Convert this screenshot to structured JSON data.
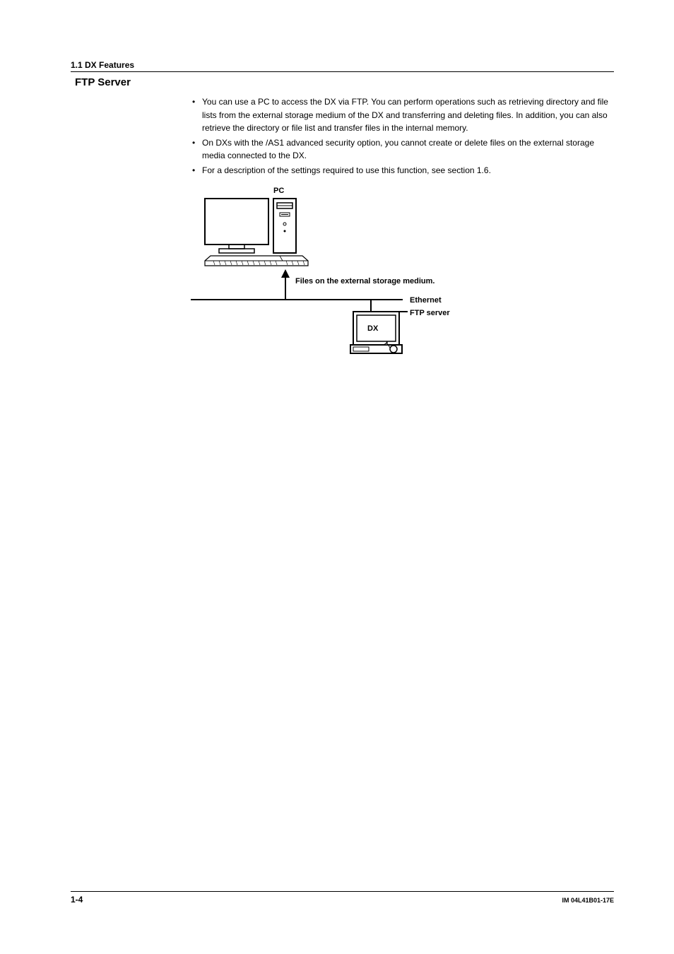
{
  "header": {
    "section": "1.1  DX Features"
  },
  "title": "FTP Server",
  "bullets": [
    "You can use a PC to access the DX via FTP.  You can perform operations such as retrieving directory and file lists from the external storage medium of the DX and transferring and deleting files.  In addition, you can also retrieve the directory or file list and transfer files in the internal memory.",
    "On DXs with the /AS1 advanced security option, you cannot create or delete files on the external storage media connected to the DX.",
    "For a description of the settings required to use this function, see section 1.6."
  ],
  "diagram": {
    "pc_label": "PC",
    "arrow_label": "Files on the external storage medium.",
    "ethernet_label": "Ethernet",
    "ftp_server_label": "FTP server",
    "dx_label": "DX"
  },
  "footer": {
    "page_num": "1-4",
    "doc_code": "IM 04L41B01-17E"
  }
}
